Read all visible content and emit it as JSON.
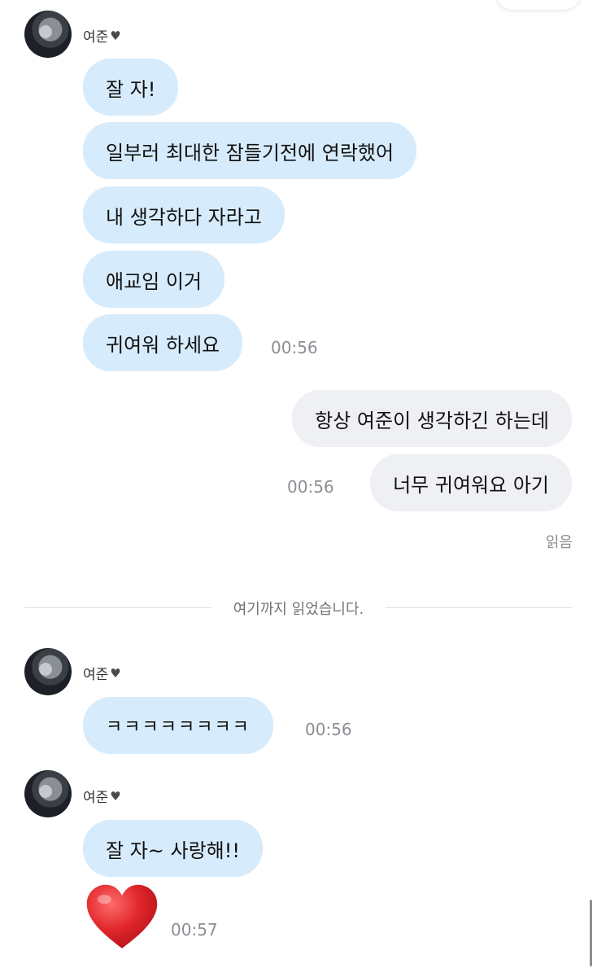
{
  "sender_name": "여준",
  "messages_block1": [
    "잘 자!",
    "일부러 최대한 잠들기전에 연락했어",
    "내 생각하다 자라고",
    "애교임 이거",
    "귀여워 하세요"
  ],
  "time_block1": "00:56",
  "my_messages": [
    "항상 여준이 생각하긴 하는데",
    "너무 귀여워요 아기"
  ],
  "my_time": "00:56",
  "read_label": "읽음",
  "divider_text": "여기까지 읽었습니다.",
  "block2_message": "ㅋㅋㅋㅋㅋㅋㅋㅋ",
  "block2_time": "00:56",
  "block3_message": "잘 자~ 사랑해!!",
  "heart_time": "00:57",
  "colors": {
    "incoming_bubble": "#d6ebfb",
    "outgoing_bubble": "#eef0f3",
    "timestamp": "#8b8f94",
    "heart": "#e0262b"
  },
  "icons": [
    "heart-emoji",
    "avatar-image"
  ]
}
